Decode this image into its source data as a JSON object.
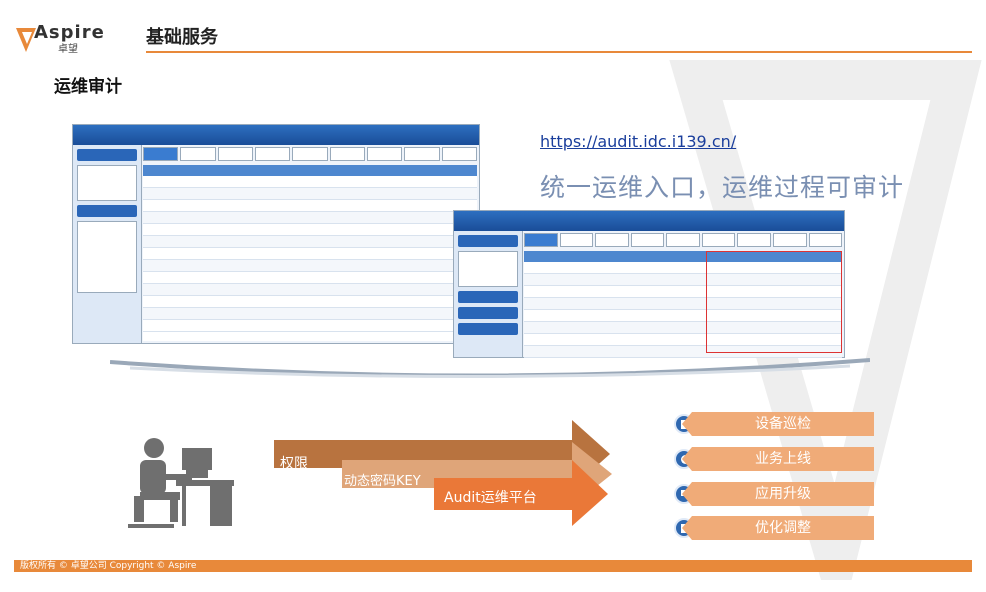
{
  "brand": {
    "name": "Aspire",
    "sub": "卓望"
  },
  "header": {
    "title": "基础服务"
  },
  "section": {
    "title": "运维审计"
  },
  "link": {
    "url": "https://audit.idc.i139.cn/"
  },
  "slogan": "统一运维入口，运维过程可审计",
  "flow": {
    "step1": "权限",
    "step2": "动态密码KEY",
    "step3": "Audit运维平台"
  },
  "tasks": [
    {
      "label": "设备巡检",
      "icon": "document-icon"
    },
    {
      "label": "业务上线",
      "icon": "globe-icon"
    },
    {
      "label": "应用升级",
      "icon": "monitor-icon"
    },
    {
      "label": "优化调整",
      "icon": "file-icon"
    }
  ],
  "footer": "版权所有 © 卓望公司 Copyright © Aspire",
  "colors": {
    "accent": "#e8893a",
    "bar": "#f0ab78",
    "flow_dark": "#b8733f",
    "flow_light": "#dfa579",
    "flow_main": "#ea7838"
  }
}
